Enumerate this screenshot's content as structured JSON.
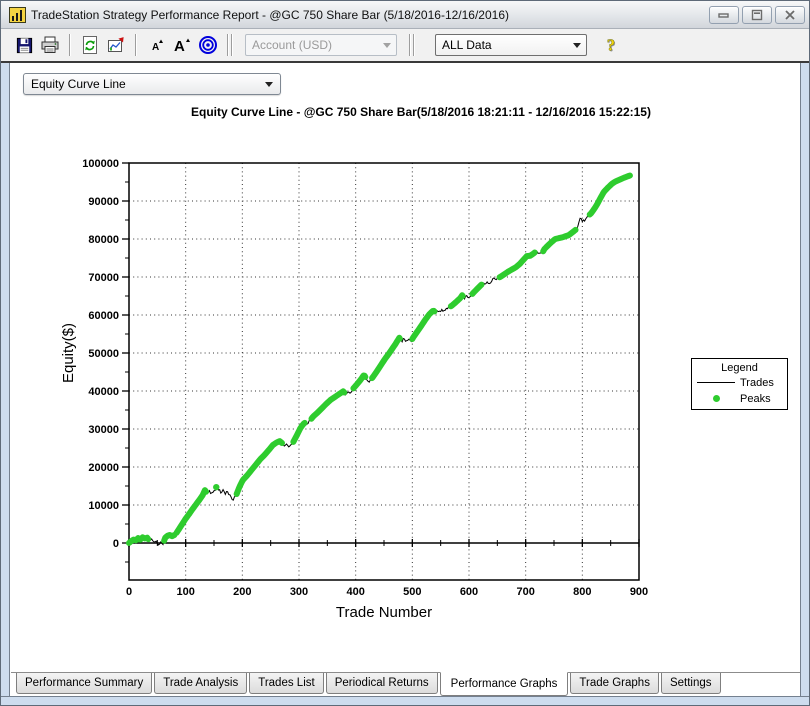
{
  "window": {
    "title": "TradeStation Strategy Performance Report - @GC 750 Share Bar (5/18/2016-12/16/2016)"
  },
  "toolbar": {
    "account_combo": {
      "value": "Account (USD)",
      "disabled": true
    },
    "data_combo": {
      "value": "ALL Data"
    }
  },
  "view_selector": {
    "value": "Equity Curve Line"
  },
  "tabs": {
    "active_index": 4,
    "items": [
      "Performance Summary",
      "Trade Analysis",
      "Trades List",
      "Periodical Returns",
      "Performance Graphs",
      "Trade Graphs",
      "Settings"
    ]
  },
  "chart_data": {
    "type": "line",
    "title": "Equity Curve Line - @GC 750 Share Bar(5/18/2016 18:21:11 - 12/16/2016 15:22:15)",
    "xlabel": "Trade Number",
    "ylabel": "Equity($)",
    "xlim": [
      0,
      900
    ],
    "ylim": [
      -10000,
      100000
    ],
    "x_ticks": [
      0,
      100,
      200,
      300,
      400,
      500,
      600,
      700,
      800,
      900
    ],
    "y_ticks": [
      0,
      10000,
      20000,
      30000,
      40000,
      50000,
      60000,
      70000,
      80000,
      90000,
      100000
    ],
    "minor_x_step": 50,
    "minor_y_step": 5000,
    "grid": "dotted",
    "colors": {
      "trades_line": "#000000",
      "peaks_dot": "#2ecc2e"
    },
    "legend": {
      "title": "Legend",
      "position": "right",
      "items": [
        {
          "label": "Trades",
          "type": "line",
          "color": "#000000"
        },
        {
          "label": "Peaks",
          "type": "dot",
          "color": "#2ecc2e"
        }
      ]
    },
    "series": [
      {
        "name": "Trades",
        "type": "line",
        "color": "#000000",
        "points": [
          [
            0,
            0
          ],
          [
            4,
            500
          ],
          [
            8,
            900
          ],
          [
            12,
            700
          ],
          [
            16,
            1300
          ],
          [
            20,
            900
          ],
          [
            24,
            1500
          ],
          [
            28,
            1200
          ],
          [
            32,
            1400
          ],
          [
            36,
            600
          ],
          [
            40,
            1000
          ],
          [
            44,
            200
          ],
          [
            48,
            700
          ],
          [
            52,
            -700
          ],
          [
            56,
            300
          ],
          [
            60,
            -200
          ],
          [
            64,
            1400
          ],
          [
            68,
            1900
          ],
          [
            72,
            2100
          ],
          [
            76,
            1800
          ],
          [
            80,
            2100
          ],
          [
            84,
            2700
          ],
          [
            88,
            3600
          ],
          [
            94,
            5000
          ],
          [
            100,
            6400
          ],
          [
            106,
            7600
          ],
          [
            112,
            8900
          ],
          [
            118,
            10100
          ],
          [
            124,
            11300
          ],
          [
            130,
            12600
          ],
          [
            134,
            13900
          ],
          [
            138,
            13100
          ],
          [
            142,
            13600
          ],
          [
            146,
            13000
          ],
          [
            150,
            13500
          ],
          [
            154,
            14700
          ],
          [
            158,
            14100
          ],
          [
            162,
            13400
          ],
          [
            166,
            13900
          ],
          [
            170,
            13100
          ],
          [
            174,
            13500
          ],
          [
            178,
            12400
          ],
          [
            182,
            11300
          ],
          [
            186,
            11900
          ],
          [
            190,
            12900
          ],
          [
            195,
            14800
          ],
          [
            201,
            16600
          ],
          [
            208,
            17700
          ],
          [
            214,
            18800
          ],
          [
            220,
            19900
          ],
          [
            226,
            21000
          ],
          [
            232,
            22100
          ],
          [
            238,
            23000
          ],
          [
            244,
            24000
          ],
          [
            248,
            24700
          ],
          [
            254,
            25800
          ],
          [
            260,
            26400
          ],
          [
            266,
            26800
          ],
          [
            270,
            26300
          ],
          [
            274,
            25500
          ],
          [
            278,
            26100
          ],
          [
            282,
            25400
          ],
          [
            286,
            25900
          ],
          [
            290,
            26600
          ],
          [
            296,
            28300
          ],
          [
            302,
            30100
          ],
          [
            307,
            31200
          ],
          [
            310,
            31600
          ],
          [
            313,
            30900
          ],
          [
            316,
            31700
          ],
          [
            320,
            32300
          ],
          [
            325,
            33300
          ],
          [
            332,
            34200
          ],
          [
            340,
            35400
          ],
          [
            348,
            36600
          ],
          [
            356,
            37700
          ],
          [
            364,
            38500
          ],
          [
            370,
            39100
          ],
          [
            378,
            39900
          ],
          [
            382,
            39300
          ],
          [
            386,
            39800
          ],
          [
            390,
            39400
          ],
          [
            396,
            40700
          ],
          [
            403,
            41900
          ],
          [
            409,
            43000
          ],
          [
            415,
            44300
          ],
          [
            419,
            43100
          ],
          [
            423,
            42500
          ],
          [
            427,
            43000
          ],
          [
            431,
            43800
          ],
          [
            438,
            45300
          ],
          [
            445,
            46900
          ],
          [
            452,
            48500
          ],
          [
            458,
            49700
          ],
          [
            464,
            51000
          ],
          [
            470,
            52300
          ],
          [
            477,
            54000
          ],
          [
            481,
            53100
          ],
          [
            485,
            53700
          ],
          [
            489,
            52900
          ],
          [
            493,
            53500
          ],
          [
            497,
            52900
          ],
          [
            502,
            54200
          ],
          [
            509,
            55700
          ],
          [
            516,
            57200
          ],
          [
            523,
            58800
          ],
          [
            530,
            60200
          ],
          [
            537,
            61200
          ],
          [
            541,
            60700
          ],
          [
            545,
            61100
          ],
          [
            549,
            60700
          ],
          [
            553,
            61400
          ],
          [
            557,
            61000
          ],
          [
            561,
            61600
          ],
          [
            566,
            62100
          ],
          [
            570,
            62500
          ],
          [
            577,
            63400
          ],
          [
            585,
            64500
          ],
          [
            588,
            65200
          ],
          [
            592,
            64400
          ],
          [
            596,
            64900
          ],
          [
            600,
            64500
          ],
          [
            604,
            65200
          ],
          [
            608,
            65900
          ],
          [
            614,
            66800
          ],
          [
            620,
            67700
          ],
          [
            624,
            68300
          ],
          [
            628,
            67900
          ],
          [
            632,
            68400
          ],
          [
            636,
            68100
          ],
          [
            640,
            69000
          ],
          [
            644,
            69800
          ],
          [
            648,
            69300
          ],
          [
            652,
            69800
          ],
          [
            655,
            70000
          ],
          [
            662,
            70700
          ],
          [
            669,
            71400
          ],
          [
            676,
            72000
          ],
          [
            683,
            72600
          ],
          [
            690,
            73500
          ],
          [
            696,
            74500
          ],
          [
            702,
            75500
          ],
          [
            708,
            75600
          ],
          [
            714,
            76200
          ],
          [
            718,
            76700
          ],
          [
            722,
            76300
          ],
          [
            726,
            76600
          ],
          [
            729,
            75900
          ],
          [
            732,
            77200
          ],
          [
            738,
            78100
          ],
          [
            745,
            79100
          ],
          [
            752,
            80000
          ],
          [
            758,
            80200
          ],
          [
            764,
            80400
          ],
          [
            770,
            80700
          ],
          [
            776,
            81000
          ],
          [
            782,
            81700
          ],
          [
            788,
            82400
          ],
          [
            793,
            83600
          ],
          [
            797,
            85900
          ],
          [
            800,
            84900
          ],
          [
            803,
            84600
          ],
          [
            807,
            85500
          ],
          [
            811,
            86300
          ],
          [
            814,
            86500
          ],
          [
            820,
            87700
          ],
          [
            826,
            89100
          ],
          [
            832,
            90800
          ],
          [
            838,
            92400
          ],
          [
            845,
            93500
          ],
          [
            852,
            94500
          ],
          [
            858,
            95100
          ],
          [
            864,
            95500
          ],
          [
            870,
            95900
          ],
          [
            875,
            96200
          ],
          [
            880,
            96500
          ],
          [
            884,
            96700
          ]
        ]
      },
      {
        "name": "Peaks",
        "type": "peak-dots",
        "color": "#2ecc2e",
        "segments": [
          [
            0,
            34
          ],
          [
            62,
            80
          ],
          [
            84,
            136
          ],
          [
            154,
            154
          ],
          [
            190,
            270
          ],
          [
            290,
            310
          ],
          [
            322,
            380
          ],
          [
            396,
            417
          ],
          [
            429,
            478
          ],
          [
            500,
            539
          ],
          [
            568,
            589
          ],
          [
            606,
            622
          ],
          [
            654,
            716
          ],
          [
            731,
            788
          ],
          [
            813,
            884
          ]
        ]
      }
    ]
  }
}
